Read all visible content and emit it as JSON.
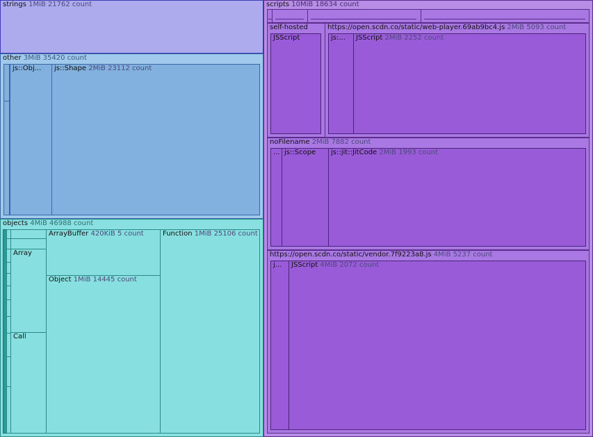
{
  "nodes": {
    "strings": {
      "name": "strings",
      "size": "1MiB",
      "count": "21762 count"
    },
    "other": {
      "name": "other",
      "size": "3MiB",
      "count": "35420 count"
    },
    "js_obj": {
      "name": "js::Obj..."
    },
    "js_shape": {
      "name": "js::Shape",
      "size": "2MiB",
      "count": "23112 count"
    },
    "objects": {
      "name": "objects",
      "size": "4MiB",
      "count": "46988 count"
    },
    "array": {
      "name": "Array"
    },
    "call": {
      "name": "Call"
    },
    "arraybuffer": {
      "name": "ArrayBuffer",
      "size": "420KiB",
      "count": "5 count"
    },
    "object": {
      "name": "Object",
      "size": "1MiB",
      "count": "14445 count"
    },
    "function": {
      "name": "Function",
      "size": "1MiB",
      "count": "25106 count"
    },
    "scripts": {
      "name": "scripts",
      "size": "10MiB",
      "count": "18634 count"
    },
    "self_hosted": {
      "name": "self-hosted"
    },
    "self_hosted_jsscript": {
      "name": "JSScript"
    },
    "web_player": {
      "name": "https://open.scdn.co/static/web-player.69ab9bc4.js",
      "size": "2MiB",
      "count": "5093 count"
    },
    "web_player_js": {
      "name": "js:..."
    },
    "web_player_jsscript": {
      "name": "JSScript",
      "size": "2MiB",
      "count": "2252 count"
    },
    "nofilename": {
      "name": "noFilename",
      "size": "2MiB",
      "count": "7882 count"
    },
    "nofilename_dots": {
      "name": "..."
    },
    "js_scope": {
      "name": "js::Scope"
    },
    "jitcode": {
      "name": "js::jit::JitCode",
      "size": "2MiB",
      "count": "1993 count"
    },
    "vendor": {
      "name": "https://open.scdn.co/static/vendor.7f9223a8.js",
      "size": "4MiB",
      "count": "5237 count"
    },
    "vendor_j": {
      "name": "j..."
    },
    "vendor_jsscript": {
      "name": "JSScript",
      "size": "4MiB",
      "count": "2072 count"
    }
  }
}
